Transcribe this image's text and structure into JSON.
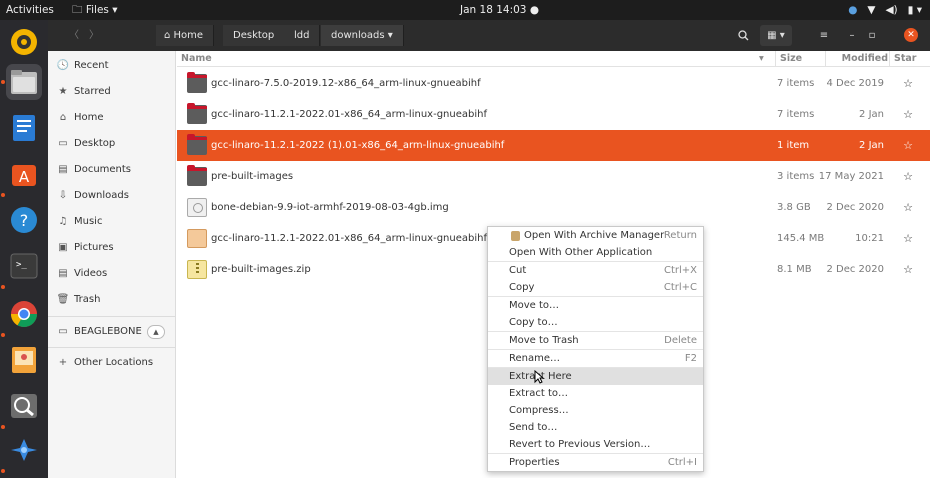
{
  "topbar": {
    "activities": "Activities",
    "app_menu": "Files ▾",
    "clock": "Jan 18  14:03",
    "tray_icons": [
      "network-icon",
      "volume-icon",
      "battery-icon",
      "system-menu-icon"
    ]
  },
  "dock": {
    "apps": [
      "rhythmbox-icon",
      "files-icon",
      "libreoffice-writer-icon",
      "software-center-icon",
      "help-icon",
      "terminal-icon",
      "chrome-icon",
      "image-viewer-icon",
      "screenshot-icon",
      "app-grid-icon"
    ]
  },
  "header": {
    "breadcrumbs": [
      "Home",
      "Desktop",
      "ldd",
      "downloads"
    ],
    "current_crumb_suffix": "▾"
  },
  "sidebar": {
    "items": [
      {
        "icon": "🕓",
        "label": "Recent"
      },
      {
        "icon": "★",
        "label": "Starred"
      },
      {
        "icon": "⌂",
        "label": "Home"
      },
      {
        "icon": "▭",
        "label": "Desktop"
      },
      {
        "icon": "▤",
        "label": "Documents"
      },
      {
        "icon": "⇩",
        "label": "Downloads"
      },
      {
        "icon": "♫",
        "label": "Music"
      },
      {
        "icon": "▣",
        "label": "Pictures"
      },
      {
        "icon": "▤",
        "label": "Videos"
      },
      {
        "icon": "🗑",
        "label": "Trash"
      }
    ],
    "device": {
      "label": "BEAGLEBONE",
      "eject": "▲"
    },
    "other": {
      "icon": "+",
      "label": "Other Locations"
    }
  },
  "columns": {
    "name": "Name",
    "size": "Size",
    "modified": "Modified",
    "star": "Star"
  },
  "files": [
    {
      "name": "gcc-linaro-7.5.0-2019.12-x86_64_arm-linux-gnueabihf",
      "size": "7 items",
      "modified": "4 Dec 2019",
      "type": "folder"
    },
    {
      "name": "gcc-linaro-11.2.1-2022.01-x86_64_arm-linux-gnueabihf",
      "size": "7 items",
      "modified": "2 Jan",
      "type": "folder"
    },
    {
      "name": "gcc-linaro-11.2.1-2022 (1).01-x86_64_arm-linux-gnueabihf",
      "size": "1 item",
      "modified": "2 Jan",
      "type": "folder",
      "selected": true
    },
    {
      "name": "pre-built-images",
      "size": "3 items",
      "modified": "17 May 2021",
      "type": "folder"
    },
    {
      "name": "bone-debian-9.9-iot-armhf-2019-08-03-4gb.img",
      "size": "3.8 GB",
      "modified": "2 Dec 2020",
      "type": "disk"
    },
    {
      "name": "gcc-linaro-11.2.1-2022.01-x86_64_arm-linux-gnueabihf.tar.xz",
      "size": "145.4 MB",
      "modified": "10:21",
      "type": "archive"
    },
    {
      "name": "pre-built-images.zip",
      "size": "8.1 MB",
      "modified": "2 Dec 2020",
      "type": "zip"
    }
  ],
  "star_glyph": "☆",
  "context_menu": {
    "items": [
      {
        "label": "Open With Archive Manager",
        "accel": "Return"
      },
      {
        "label": "Open With Other Application",
        "accel": ""
      },
      {
        "label": "Cut",
        "accel": "Ctrl+X"
      },
      {
        "label": "Copy",
        "accel": "Ctrl+C"
      },
      {
        "label": "Move to…",
        "accel": ""
      },
      {
        "label": "Copy to…",
        "accel": ""
      },
      {
        "label": "Move to Trash",
        "accel": "Delete"
      },
      {
        "label": "Rename…",
        "accel": "F2"
      },
      {
        "label": "Extract Here",
        "accel": ""
      },
      {
        "label": "Extract to…",
        "accel": ""
      },
      {
        "label": "Compress…",
        "accel": ""
      },
      {
        "label": "Send to…",
        "accel": ""
      },
      {
        "label": "Revert to Previous Version…",
        "accel": ""
      },
      {
        "label": "Properties",
        "accel": "Ctrl+I"
      }
    ]
  },
  "colors": {
    "accent": "#e95420",
    "topbar": "#1d1d1d",
    "dock": "#2a2a2e",
    "headerbar": "#2c2c2c"
  }
}
